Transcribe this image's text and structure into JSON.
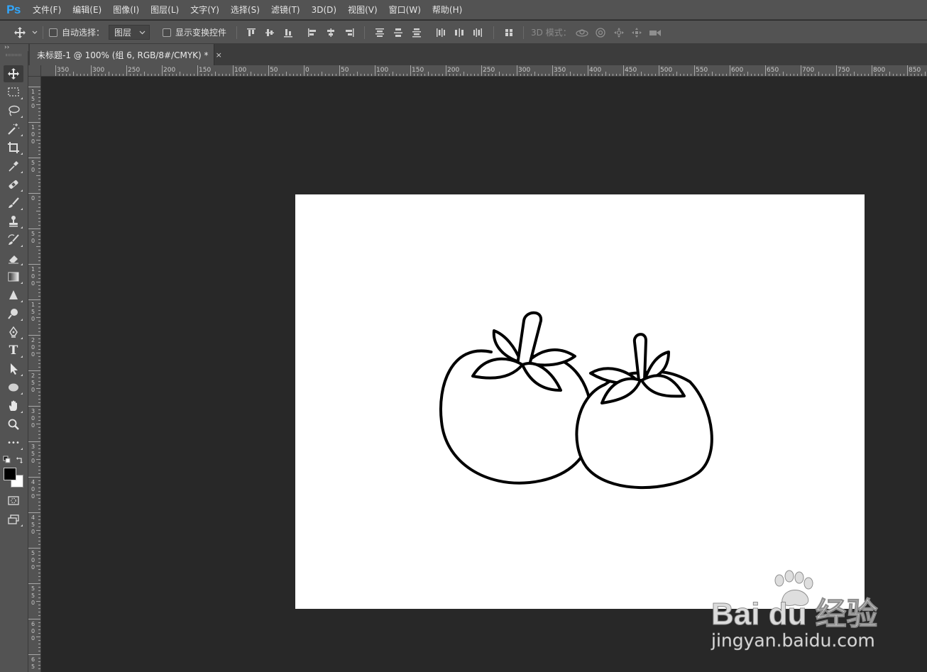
{
  "app": {
    "logo_text": "Ps"
  },
  "menu": [
    {
      "label": "文件(F)"
    },
    {
      "label": "编辑(E)"
    },
    {
      "label": "图像(I)"
    },
    {
      "label": "图层(L)"
    },
    {
      "label": "文字(Y)"
    },
    {
      "label": "选择(S)"
    },
    {
      "label": "滤镜(T)"
    },
    {
      "label": "3D(D)"
    },
    {
      "label": "视图(V)"
    },
    {
      "label": "窗口(W)"
    },
    {
      "label": "帮助(H)"
    }
  ],
  "options_bar": {
    "auto_select_label": "自动选择：",
    "auto_select_checked": false,
    "layer_select_value": "图层",
    "show_transform_label": "显示变换控件",
    "show_transform_checked": false,
    "mode_3d_label": "3D 模式："
  },
  "document_tab": {
    "title": "未标题-1 @ 100% (组 6, RGB/8#/CMYK) *",
    "close_glyph": "×"
  },
  "panel_collapse_glyph": "››",
  "rulers": {
    "horizontal_labels": [
      "350",
      "300",
      "250",
      "200",
      "150",
      "100",
      "50",
      "0",
      "50",
      "100",
      "150",
      "200",
      "250",
      "300",
      "350",
      "400",
      "450",
      "500",
      "550",
      "600",
      "650",
      "700",
      "750",
      "800",
      "850"
    ],
    "vertical_labels": [
      "150",
      "100",
      "50",
      "0",
      "50",
      "100",
      "150",
      "200",
      "250",
      "300",
      "350",
      "400",
      "450",
      "500",
      "550",
      "600",
      "65"
    ]
  },
  "toolbar": {
    "tools": [
      {
        "name": "move-tool-icon",
        "active": true
      },
      {
        "name": "rectangular-marquee-tool-icon"
      },
      {
        "name": "lasso-tool-icon"
      },
      {
        "name": "magic-wand-tool-icon"
      },
      {
        "name": "crop-tool-icon"
      },
      {
        "name": "eyedropper-tool-icon"
      },
      {
        "name": "healing-brush-tool-icon"
      },
      {
        "name": "brush-tool-icon"
      },
      {
        "name": "clone-stamp-tool-icon"
      },
      {
        "name": "history-brush-tool-icon"
      },
      {
        "name": "eraser-tool-icon"
      },
      {
        "name": "gradient-tool-icon"
      },
      {
        "name": "blur-tool-icon"
      },
      {
        "name": "dodge-tool-icon"
      },
      {
        "name": "pen-tool-icon"
      },
      {
        "name": "type-tool-icon"
      },
      {
        "name": "path-selection-tool-icon"
      },
      {
        "name": "ellipse-tool-icon"
      },
      {
        "name": "hand-tool-icon"
      },
      {
        "name": "zoom-tool-icon"
      },
      {
        "name": "edit-toolbar-icon"
      }
    ],
    "type_tool_glyph": "T",
    "more_glyph": "•••",
    "foreground_color": "#000000",
    "background_color": "#ffffff"
  },
  "canvas": {
    "workspace_color": "#282828",
    "document_background": "#ffffff",
    "artwork": "two-tomatoes-line-drawing"
  },
  "watermark": {
    "brand": "Bai du 经验",
    "url": "jingyan.baidu.com"
  },
  "colors": {
    "ui_panel": "#535353",
    "ui_dark": "#3c3c3c",
    "ps_blue": "#31a8ff"
  }
}
